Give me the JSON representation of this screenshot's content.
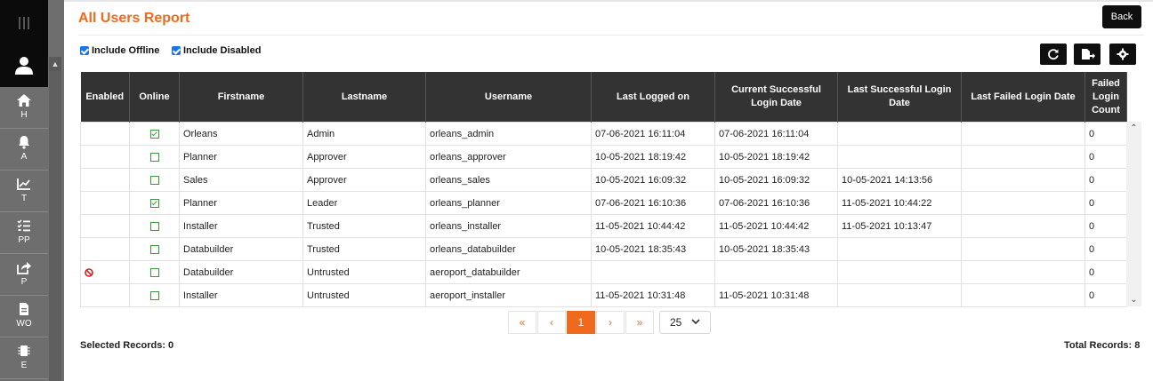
{
  "page": {
    "title": "All Users Report",
    "back_label": "Back"
  },
  "filters": {
    "include_offline": "Include Offline",
    "include_disabled": "Include Disabled"
  },
  "sidebar": {
    "items": [
      {
        "label": "H",
        "icon": "home-icon"
      },
      {
        "label": "A",
        "icon": "bell-icon"
      },
      {
        "label": "T",
        "icon": "chart-icon"
      },
      {
        "label": "PP",
        "icon": "checklist-icon"
      },
      {
        "label": "P",
        "icon": "share-icon"
      },
      {
        "label": "WO",
        "icon": "document-icon"
      },
      {
        "label": "E",
        "icon": "chip-icon"
      }
    ]
  },
  "table": {
    "headers": [
      "Enabled",
      "Online",
      "Firstname",
      "Lastname",
      "Username",
      "Last Logged on",
      "Current Successful Login Date",
      "Last Successful Login Date",
      "Last Failed Login Date",
      "Failed Login Count"
    ],
    "rows": [
      {
        "enabled": true,
        "online": true,
        "firstname": "Orleans",
        "lastname": "Admin",
        "username": "orleans_admin",
        "last_logged_on": "07-06-2021 16:11:04",
        "current_success": "07-06-2021 16:11:04",
        "last_success": "",
        "last_failed": "",
        "failed_count": "0"
      },
      {
        "enabled": true,
        "online": false,
        "firstname": "Planner",
        "lastname": "Approver",
        "username": "orleans_approver",
        "last_logged_on": "10-05-2021 18:19:42",
        "current_success": "10-05-2021 18:19:42",
        "last_success": "",
        "last_failed": "",
        "failed_count": "0"
      },
      {
        "enabled": true,
        "online": false,
        "firstname": "Sales",
        "lastname": "Approver",
        "username": "orleans_sales",
        "last_logged_on": "10-05-2021 16:09:32",
        "current_success": "10-05-2021 16:09:32",
        "last_success": "10-05-2021 14:13:56",
        "last_failed": "",
        "failed_count": "0"
      },
      {
        "enabled": true,
        "online": true,
        "firstname": "Planner",
        "lastname": "Leader",
        "username": "orleans_planner",
        "last_logged_on": "07-06-2021 16:10:36",
        "current_success": "07-06-2021 16:10:36",
        "last_success": "11-05-2021 10:44:22",
        "last_failed": "",
        "failed_count": "0"
      },
      {
        "enabled": true,
        "online": false,
        "firstname": "Installer",
        "lastname": "Trusted",
        "username": "orleans_installer",
        "last_logged_on": "11-05-2021 10:44:42",
        "current_success": "11-05-2021 10:44:42",
        "last_success": "11-05-2021 10:13:47",
        "last_failed": "",
        "failed_count": "0"
      },
      {
        "enabled": true,
        "online": false,
        "firstname": "Databuilder",
        "lastname": "Trusted",
        "username": "orleans_databuilder",
        "last_logged_on": "10-05-2021 18:35:43",
        "current_success": "10-05-2021 18:35:43",
        "last_success": "",
        "last_failed": "",
        "failed_count": "0"
      },
      {
        "enabled": false,
        "online": false,
        "firstname": "Databuilder",
        "lastname": "Untrusted",
        "username": "aeroport_databuilder",
        "last_logged_on": "",
        "current_success": "",
        "last_success": "",
        "last_failed": "",
        "failed_count": "0"
      },
      {
        "enabled": true,
        "online": false,
        "firstname": "Installer",
        "lastname": "Untrusted",
        "username": "aeroport_installer",
        "last_logged_on": "11-05-2021 10:31:48",
        "current_success": "11-05-2021 10:31:48",
        "last_success": "",
        "last_failed": "",
        "failed_count": "0"
      }
    ]
  },
  "pagination": {
    "first": "«",
    "prev": "‹",
    "current": "1",
    "next": "›",
    "last": "»",
    "page_size": "25"
  },
  "footer": {
    "selected": "Selected Records: 0",
    "total": "Total Records: 8"
  },
  "colors": {
    "accent": "#f06a1d",
    "header_bg": "#333333",
    "sidebar_bg": "#6e6e6e"
  }
}
